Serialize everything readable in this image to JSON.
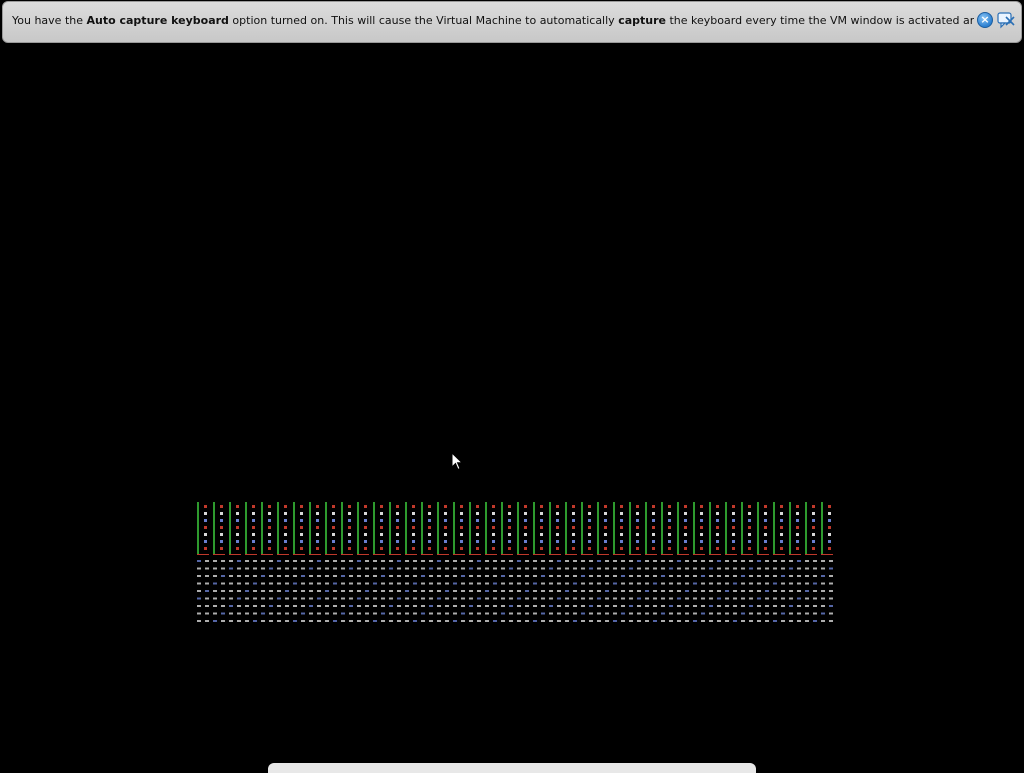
{
  "notification": {
    "text_1": "You have the ",
    "bold_1": "Auto capture keyboard",
    "text_2": " option turned on. This will cause the Virtual Machine to automatically ",
    "bold_2": "capture",
    "text_3": " the keyboard every time the VM window is activated and make it unavailable to",
    "close_icon": "close-icon",
    "settings_icon": "do-not-show-again-icon"
  },
  "vm": {
    "background_color": "#000000",
    "cursor_icon": "mouse-pointer-icon",
    "pattern_colors": {
      "green": "#2e9a2e",
      "red": "#c0392b",
      "white": "#d8d8d8",
      "blue": "#6a7fd0"
    }
  }
}
